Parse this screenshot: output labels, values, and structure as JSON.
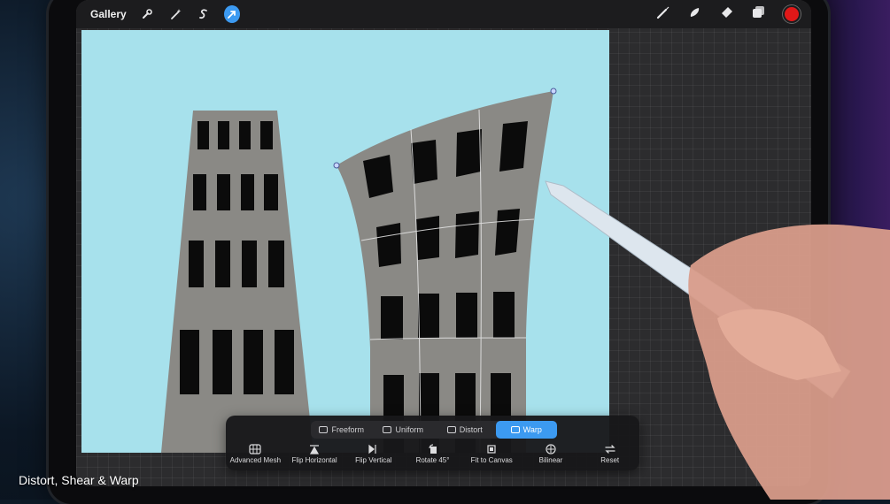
{
  "topbar": {
    "gallery_label": "Gallery",
    "left_icons": [
      "wrench-icon",
      "magic-wand-icon",
      "selection-s-icon",
      "transform-arrow-icon"
    ],
    "right_icons": [
      "brush-icon",
      "smudge-icon",
      "eraser-icon",
      "layers-icon",
      "color-swatch-icon"
    ],
    "active_color": "#e01818",
    "accent": "#3c9af1"
  },
  "transform": {
    "modes": [
      {
        "label": "Freeform",
        "active": false
      },
      {
        "label": "Uniform",
        "active": false
      },
      {
        "label": "Distort",
        "active": false
      },
      {
        "label": "Warp",
        "active": true
      }
    ],
    "actions": [
      {
        "label": "Advanced Mesh",
        "icon": "mesh-grid-icon"
      },
      {
        "label": "Flip Horizontal",
        "icon": "flip-horizontal-icon"
      },
      {
        "label": "Flip Vertical",
        "icon": "flip-vertical-icon"
      },
      {
        "label": "Rotate 45°",
        "icon": "rotate-icon"
      },
      {
        "label": "Fit to Canvas",
        "icon": "fit-canvas-icon"
      },
      {
        "label": "Bilinear",
        "icon": "bilinear-icon"
      },
      {
        "label": "Reset",
        "icon": "reset-icon"
      }
    ]
  },
  "caption": "Distort, Shear & Warp",
  "colors": {
    "canvas_bg": "#a7e1ec",
    "building": "#8a8985",
    "window": "#0b0b0b"
  }
}
